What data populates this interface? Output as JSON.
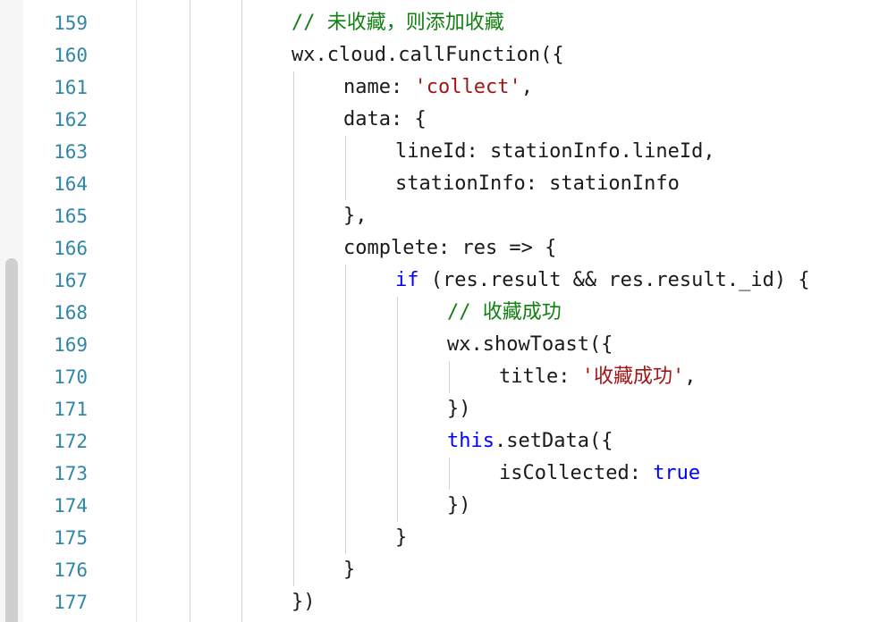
{
  "editor": {
    "lines": [
      {
        "number": "159",
        "indent": 3,
        "tokens": [
          {
            "text": "// 未收藏，则添加收藏",
            "type": "comment"
          }
        ]
      },
      {
        "number": "160",
        "indent": 3,
        "tokens": [
          {
            "text": "wx.cloud.callFunction({",
            "type": "plain"
          }
        ]
      },
      {
        "number": "161",
        "indent": 4,
        "tokens": [
          {
            "text": "name: ",
            "type": "plain"
          },
          {
            "text": "'collect'",
            "type": "string"
          },
          {
            "text": ",",
            "type": "plain"
          }
        ]
      },
      {
        "number": "162",
        "indent": 4,
        "tokens": [
          {
            "text": "data: {",
            "type": "plain"
          }
        ]
      },
      {
        "number": "163",
        "indent": 5,
        "tokens": [
          {
            "text": "lineId: stationInfo.lineId,",
            "type": "plain"
          }
        ]
      },
      {
        "number": "164",
        "indent": 5,
        "tokens": [
          {
            "text": "stationInfo: stationInfo",
            "type": "plain"
          }
        ]
      },
      {
        "number": "165",
        "indent": 4,
        "tokens": [
          {
            "text": "},",
            "type": "plain"
          }
        ]
      },
      {
        "number": "166",
        "indent": 4,
        "tokens": [
          {
            "text": "complete: res => {",
            "type": "plain"
          }
        ]
      },
      {
        "number": "167",
        "indent": 5,
        "tokens": [
          {
            "text": "if",
            "type": "keyword"
          },
          {
            "text": " (res.result && res.result._id) {",
            "type": "plain"
          }
        ]
      },
      {
        "number": "168",
        "indent": 6,
        "tokens": [
          {
            "text": "// 收藏成功",
            "type": "comment"
          }
        ]
      },
      {
        "number": "169",
        "indent": 6,
        "tokens": [
          {
            "text": "wx.showToast({",
            "type": "plain"
          }
        ]
      },
      {
        "number": "170",
        "indent": 7,
        "tokens": [
          {
            "text": "title: ",
            "type": "plain"
          },
          {
            "text": "'收藏成功'",
            "type": "string"
          },
          {
            "text": ",",
            "type": "plain"
          }
        ]
      },
      {
        "number": "171",
        "indent": 6,
        "tokens": [
          {
            "text": "})",
            "type": "plain"
          }
        ]
      },
      {
        "number": "172",
        "indent": 6,
        "tokens": [
          {
            "text": "this",
            "type": "keyword"
          },
          {
            "text": ".setData({",
            "type": "plain"
          }
        ]
      },
      {
        "number": "173",
        "indent": 7,
        "tokens": [
          {
            "text": "isCollected: ",
            "type": "plain"
          },
          {
            "text": "true",
            "type": "keyword"
          }
        ]
      },
      {
        "number": "174",
        "indent": 6,
        "tokens": [
          {
            "text": "})",
            "type": "plain"
          }
        ]
      },
      {
        "number": "175",
        "indent": 5,
        "tokens": [
          {
            "text": "}",
            "type": "plain"
          }
        ]
      },
      {
        "number": "176",
        "indent": 4,
        "tokens": [
          {
            "text": "}",
            "type": "plain"
          }
        ]
      },
      {
        "number": "177",
        "indent": 3,
        "tokens": [
          {
            "text": "})",
            "type": "plain"
          }
        ]
      }
    ]
  },
  "colors": {
    "line_number": "#2f86a6",
    "plain": "#1a1a1a",
    "string": "#a31515",
    "keyword": "#0000ff",
    "comment": "#108010"
  }
}
